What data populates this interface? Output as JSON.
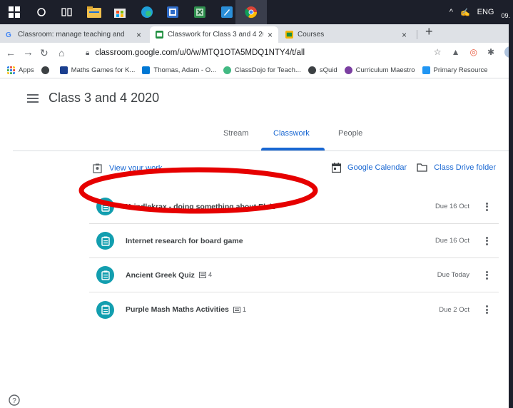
{
  "browser": {
    "tabs": [
      {
        "label": "Classroom: manage teaching and"
      },
      {
        "label": "Classwork for Class 3 and 4 2020"
      },
      {
        "label": "Courses"
      }
    ],
    "url": "classroom.google.com/u/0/w/MTQ1OTA5MDQ1NTY4/t/all",
    "bookmarks": [
      {
        "label": "Apps",
        "color": "#1a73e8"
      },
      {
        "label": "",
        "color": "#3c4043"
      },
      {
        "label": "Maths Games for K...",
        "color": "#1b3f8f"
      },
      {
        "label": "Thomas, Adam - O...",
        "color": "#0078d4"
      },
      {
        "label": "ClassDojo for Teach...",
        "color": "#42b983"
      },
      {
        "label": "sQuid",
        "color": "#3c4043"
      },
      {
        "label": "Curriculum Maestro",
        "color": "#7b3fa1"
      },
      {
        "label": "Primary Resource",
        "color": "#2196f3"
      }
    ]
  },
  "taskbar": {
    "language": "ENG",
    "clock": "09."
  },
  "classroom": {
    "title": "Class 3 and 4 2020",
    "nav": {
      "stream": "Stream",
      "classwork": "Classwork",
      "people": "People"
    },
    "view_work": "View your work",
    "google_calendar": "Google Calendar",
    "drive_folder": "Class Drive folder",
    "assignments": [
      {
        "title": "Krindlekrax - doing something about Elvis",
        "comments": "",
        "due": "Due 16 Oct"
      },
      {
        "title": "Internet research for board game",
        "comments": "",
        "due": "Due 16 Oct"
      },
      {
        "title": "Ancient Greek Quiz",
        "comments": "4",
        "due": "Due Today"
      },
      {
        "title": "Purple Mash Maths Activities",
        "comments": "1",
        "due": "Due 2 Oct"
      }
    ],
    "accent": "#1967d2",
    "assignment_icon_color": "#129eaf",
    "annotation_color": "#e60000"
  }
}
